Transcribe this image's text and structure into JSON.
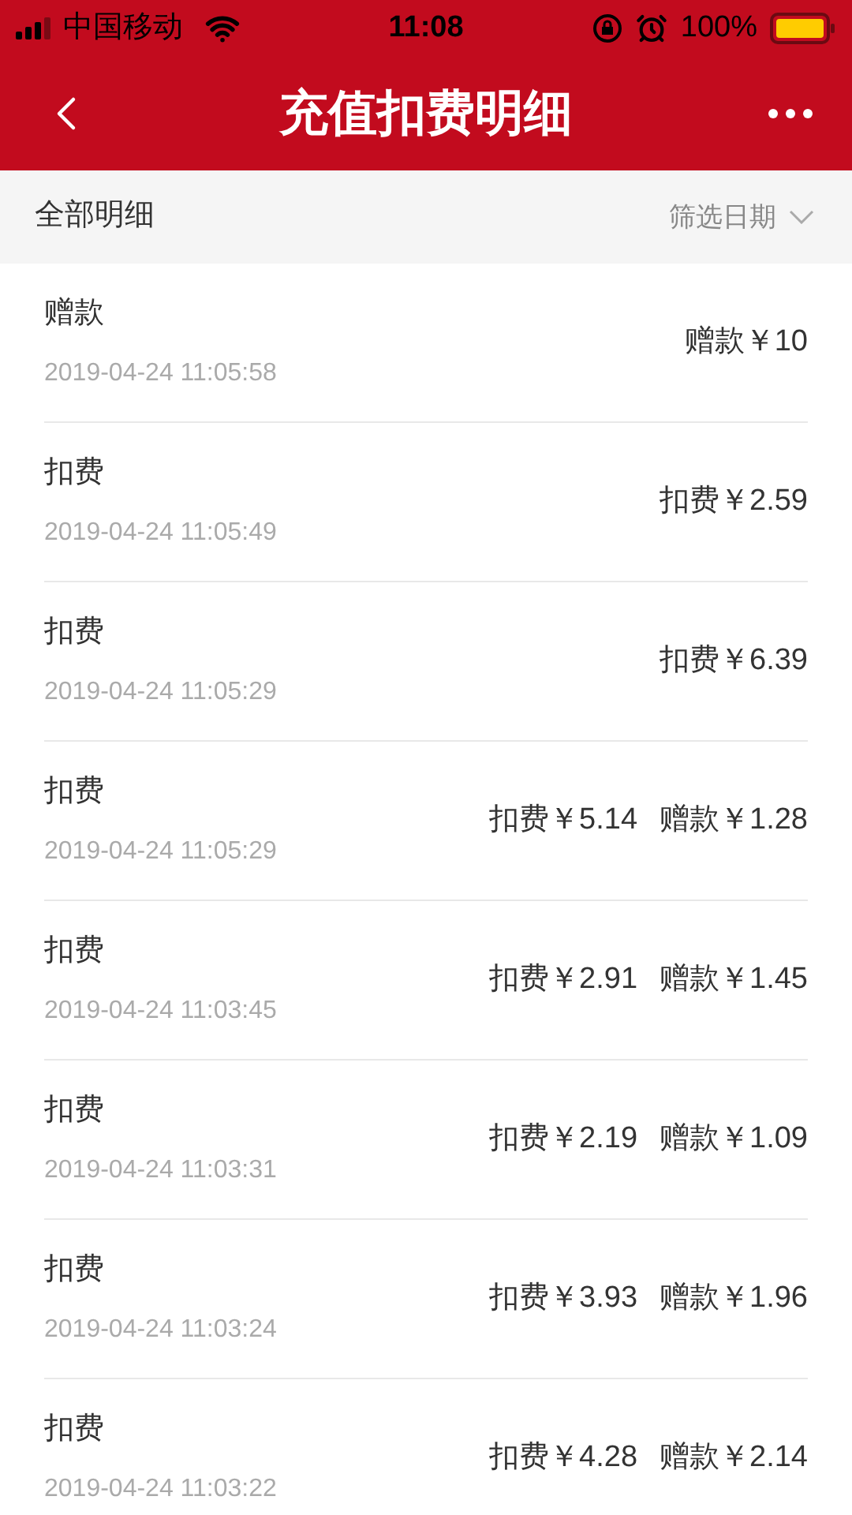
{
  "status_bar": {
    "carrier": "中国移动",
    "time": "11:08",
    "battery": "100%"
  },
  "nav": {
    "title": "充值扣费明细"
  },
  "filter_bar": {
    "label": "全部明细",
    "date_filter": "筛选日期"
  },
  "records": [
    {
      "type": "赠款",
      "time": "2019-04-24 11:05:58",
      "amounts": [
        "赠款￥10"
      ]
    },
    {
      "type": "扣费",
      "time": "2019-04-24 11:05:49",
      "amounts": [
        "扣费￥2.59"
      ]
    },
    {
      "type": "扣费",
      "time": "2019-04-24 11:05:29",
      "amounts": [
        "扣费￥6.39"
      ]
    },
    {
      "type": "扣费",
      "time": "2019-04-24 11:05:29",
      "amounts": [
        "扣费￥5.14",
        "赠款￥1.28"
      ]
    },
    {
      "type": "扣费",
      "time": "2019-04-24 11:03:45",
      "amounts": [
        "扣费￥2.91",
        "赠款￥1.45"
      ]
    },
    {
      "type": "扣费",
      "time": "2019-04-24 11:03:31",
      "amounts": [
        "扣费￥2.19",
        "赠款￥1.09"
      ]
    },
    {
      "type": "扣费",
      "time": "2019-04-24 11:03:24",
      "amounts": [
        "扣费￥3.93",
        "赠款￥1.96"
      ]
    },
    {
      "type": "扣费",
      "time": "2019-04-24 11:03:22",
      "amounts": [
        "扣费￥4.28",
        "赠款￥2.14"
      ]
    }
  ]
}
